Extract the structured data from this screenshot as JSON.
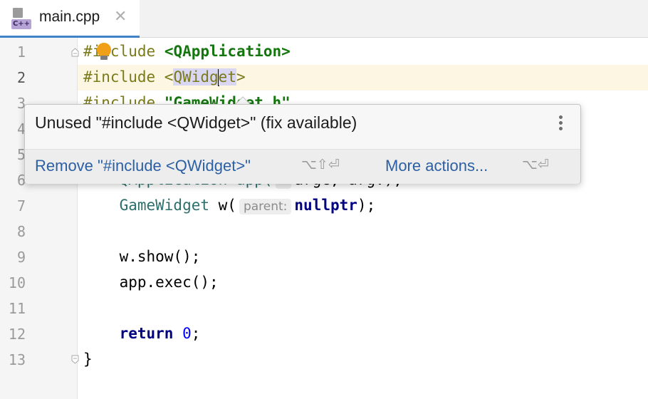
{
  "tab": {
    "icon_label": "C++",
    "filename": "main.cpp",
    "close_glyph": "✕"
  },
  "gutter": {
    "lines": [
      "1",
      "2",
      "3",
      "4",
      "5",
      "6",
      "7",
      "8",
      "9",
      "10",
      "11",
      "12",
      "13"
    ]
  },
  "code": {
    "l1_pp": "#include",
    "l1_str": "<QApplication>",
    "l2_pp": "#include ",
    "l2_open": "<",
    "l2_sel_a": "QWidg",
    "l2_sel_b": "et",
    "l2_close": ">",
    "l3_pp": "#include ",
    "l3_str": "\"GameWidget.h\"",
    "l6_prefix": "    QApplication app(",
    "l6_rest": "argc, argv);",
    "l7_class": "GameWidget",
    "l7_mid": " w(",
    "l7_hint": "parent:",
    "l7_kw": "nullptr",
    "l7_end": ");",
    "l9": "w.show();",
    "l10": "app.exec();",
    "l12_kw": "return",
    "l12_num": "0",
    "l12_end": ";",
    "l13": "}"
  },
  "popup": {
    "message": "Unused \"#include <QWidget>\" (fix available)",
    "primary_action": "Remove \"#include <QWidget>\"",
    "primary_shortcut": "⌥⇧⏎",
    "more_action": "More actions...",
    "more_shortcut": "⌥⏎"
  },
  "colors": {
    "accent": "#4083c9",
    "link": "#2c5fa3",
    "string": "#15760f",
    "preprocessor": "#7a7a1a",
    "keyword": "#000080",
    "number": "#0000ff",
    "current_line": "#fcf6e2"
  },
  "icons": [
    "cpp-file-icon",
    "close-icon",
    "fold-icon",
    "bulb-icon",
    "more-vertical-icon"
  ]
}
